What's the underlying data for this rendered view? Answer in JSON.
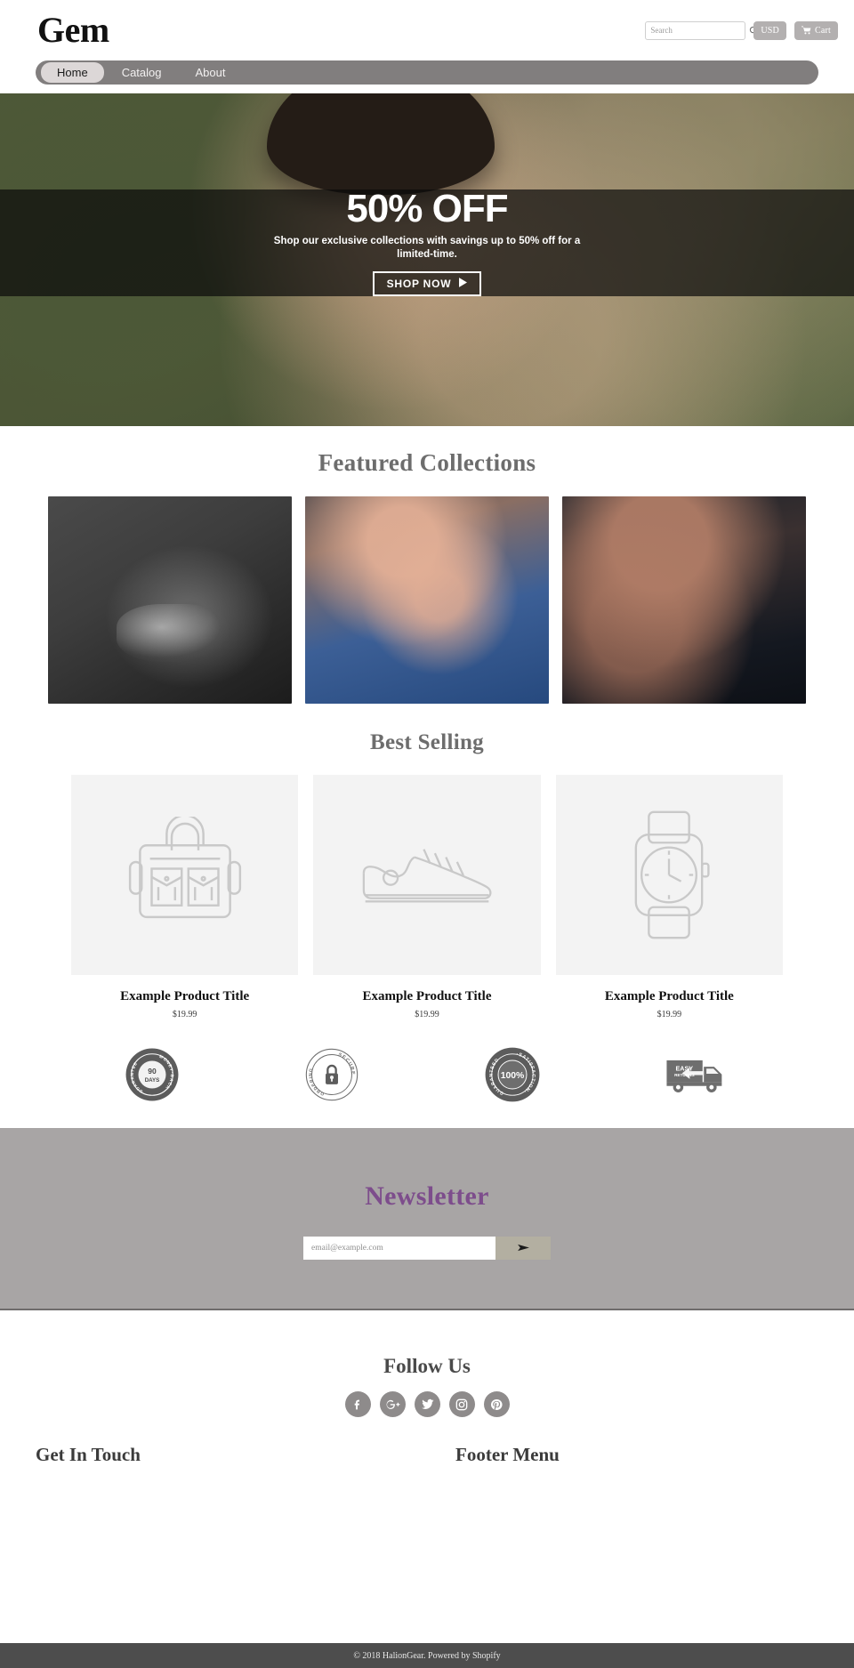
{
  "header": {
    "brand": "Gem",
    "search": {
      "placeholder": "Search",
      "value": "",
      "icon": "search-icon"
    },
    "currency_label": "USD",
    "cart_label": "Cart",
    "cart_icon": "cart-icon"
  },
  "nav": {
    "items": [
      {
        "label": "Home",
        "active": true
      },
      {
        "label": "Catalog",
        "active": false
      },
      {
        "label": "About",
        "active": false
      }
    ]
  },
  "hero": {
    "title": "50% OFF",
    "subtitle": "Shop our exclusive collections with savings up to 50% off for a limited-time.",
    "cta_label": "SHOP NOW",
    "cta_icon": "play-arrow-icon"
  },
  "featured": {
    "title": "Featured Collections",
    "items": [
      {
        "name": "collection-rings-bw"
      },
      {
        "name": "collection-turquoise-ring"
      },
      {
        "name": "collection-necklace"
      }
    ]
  },
  "best_selling": {
    "title": "Best Selling",
    "products": [
      {
        "title": "Example Product Title",
        "price": "$19.99",
        "icon": "bag-icon"
      },
      {
        "title": "Example Product Title",
        "price": "$19.99",
        "icon": "shoe-icon"
      },
      {
        "title": "Example Product Title",
        "price": "$19.99",
        "icon": "watch-icon"
      }
    ]
  },
  "badges": [
    {
      "name": "money-back-90-days-badge",
      "line1": "MONEY BACK",
      "line2": "90",
      "line3": "DAYS",
      "line4": "GUARANTEE"
    },
    {
      "name": "secure-ordering-badge",
      "line1": "SECURE",
      "line2": "ORDERING"
    },
    {
      "name": "satisfaction-guaranteed-badge",
      "line1": "SATISFACTION",
      "line2": "100%",
      "line3": "GUARANTEED"
    },
    {
      "name": "easy-returns-badge",
      "line1": "EASY",
      "line2": "RETURNS"
    }
  ],
  "newsletter": {
    "title": "Newsletter",
    "placeholder": "email@example.com",
    "value": "",
    "submit_icon": "send-arrow-icon"
  },
  "follow": {
    "title": "Follow Us",
    "socials": [
      {
        "name": "facebook-icon"
      },
      {
        "name": "google-plus-icon"
      },
      {
        "name": "twitter-icon"
      },
      {
        "name": "instagram-icon"
      },
      {
        "name": "pinterest-icon"
      }
    ]
  },
  "footer": {
    "get_in_touch_title": "Get In Touch",
    "footer_menu_title": "Footer Menu",
    "copyright": "© 2018 HalionGear. Powered by Shopify"
  },
  "colors": {
    "nav_bar": "#817e7e",
    "nav_active": "#dcd7d7",
    "newsletter_bg": "#a8a5a5",
    "newsletter_title": "#7d4d8c",
    "button_gray": "#b3b0b0",
    "submit_tan": "#b3afa1",
    "copyright_bg": "#4d4d4d",
    "heading_gray": "#6d6d6d"
  }
}
